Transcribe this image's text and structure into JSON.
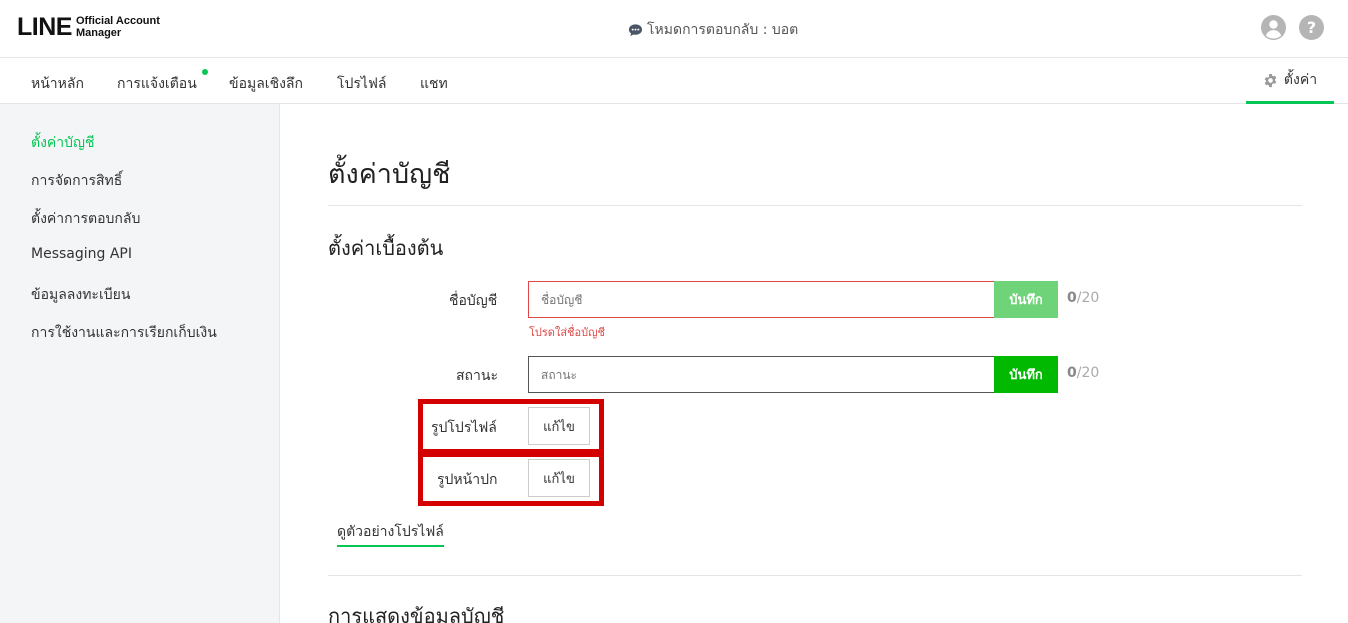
{
  "header": {
    "logo_main": "LINE",
    "logo_sub_1": "Official Account",
    "logo_sub_2": "Manager",
    "mode_text": "โหมดการตอบกลับ : บอต",
    "help_glyph": "?"
  },
  "nav": {
    "items": [
      {
        "label": "หน้าหลัก"
      },
      {
        "label": "การแจ้งเตือน"
      },
      {
        "label": "ข้อมูลเชิงลึก"
      },
      {
        "label": "โปรไฟล์"
      },
      {
        "label": "แชท"
      }
    ],
    "settings_label": "ตั้งค่า",
    "accent_color": "#06c755"
  },
  "sidebar": {
    "items": [
      {
        "label": "ตั้งค่าบัญชี",
        "active": true
      },
      {
        "label": "การจัดการสิทธิ์"
      },
      {
        "label": "ตั้งค่าการตอบกลับ"
      },
      {
        "label": "Messaging API"
      },
      {
        "label": "ข้อมูลลงทะเบียน"
      },
      {
        "label": "การใช้งานและการเรียกเก็บเงิน"
      }
    ]
  },
  "main": {
    "title": "ตั้งค่าบัญชี",
    "section_basic": "ตั้งค่าเบื้องต้น",
    "account_name": {
      "label": "ชื่อบัญชี",
      "placeholder": "ชื่อบัญชี",
      "value": "",
      "save_label": "บันทึก",
      "count": "0",
      "max": "/20",
      "error": "โปรดใส่ชื่อบัญชี"
    },
    "status": {
      "label": "สถานะ",
      "placeholder": "สถานะ",
      "value": "",
      "save_label": "บันทึก",
      "count": "0",
      "max": "/20"
    },
    "profile_image": {
      "label": "รูปโปรไฟล์",
      "edit_label": "แก้ไข"
    },
    "cover_image": {
      "label": "รูปหน้าปก",
      "edit_label": "แก้ไข"
    },
    "preview_link": "ดูตัวอย่างโปรไฟล์",
    "section_display": "การแสดงข้อมูลบัญชี",
    "colors": {
      "save_disabled": "#6fd37a",
      "save_enabled": "#00b900",
      "error": "#e04848",
      "highlight": "#d40000"
    }
  }
}
